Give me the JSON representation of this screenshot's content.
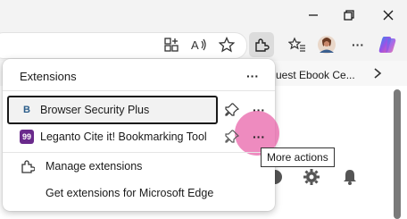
{
  "window": {
    "controls": [
      {
        "name": "minimize-icon"
      },
      {
        "name": "restore-icon"
      },
      {
        "name": "close-icon"
      }
    ]
  },
  "toolbar": {
    "icons": [
      "app-grid-icon",
      "read-aloud-icon",
      "favorite-star-icon",
      "extensions-icon",
      "favorites-icon",
      "profile-avatar",
      "more-icon",
      "copilot-icon"
    ],
    "more_label": "···"
  },
  "favorites_bar": {
    "item_text": "uest Ebook Ce..."
  },
  "extensions_panel": {
    "title": "Extensions",
    "more_label": "···",
    "extensions": [
      {
        "name": "Browser Security Plus",
        "icon_letter": "B",
        "more_label": "···"
      },
      {
        "name": "Leganto Cite it! Bookmarking Tool",
        "icon_letter": "99",
        "more_label": "···"
      }
    ],
    "manage_label": "Manage extensions",
    "get_label": "Get extensions for Microsoft Edge"
  },
  "tooltip": {
    "text": "More actions"
  },
  "colors": {
    "accent_pink": "#e864aa",
    "leganto_purple": "#6a2a8c",
    "bsp_blue": "#2b5d8a"
  }
}
